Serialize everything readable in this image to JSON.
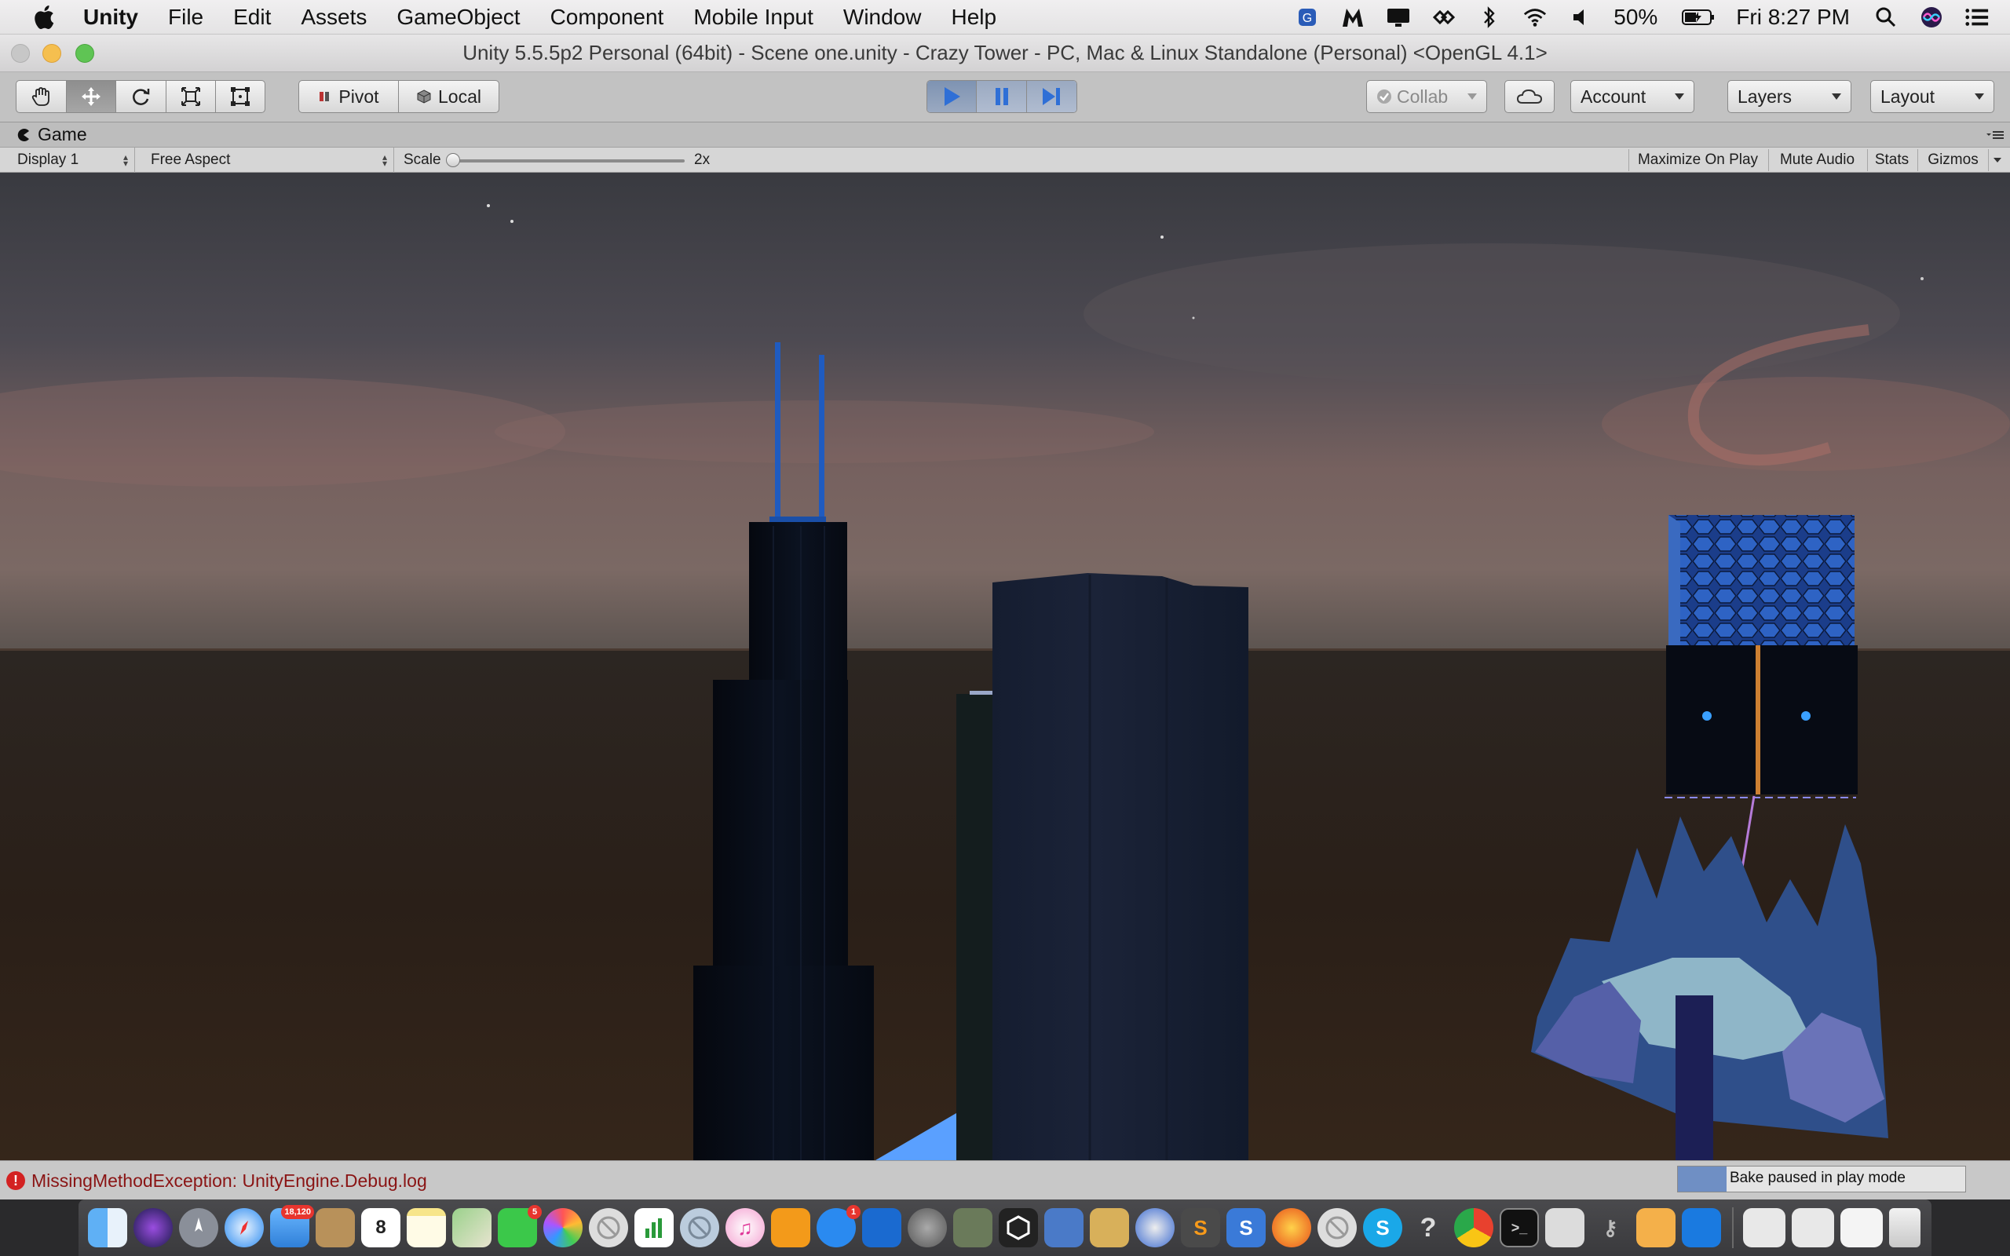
{
  "menubar": {
    "app_name": "Unity",
    "items": [
      "File",
      "Edit",
      "Assets",
      "GameObject",
      "Component",
      "Mobile Input",
      "Window",
      "Help"
    ],
    "battery": "50%",
    "clock": "Fri 8:27 PM"
  },
  "window": {
    "title": "Unity 5.5.5p2 Personal (64bit) - Scene one.unity - Crazy Tower - PC, Mac & Linux Standalone (Personal) <OpenGL 4.1>"
  },
  "toolbar": {
    "pivot_label": "Pivot",
    "local_label": "Local",
    "collab_label": "Collab",
    "account_label": "Account",
    "layers_label": "Layers",
    "layout_label": "Layout"
  },
  "game_view": {
    "tab_label": "Game",
    "display": "Display 1",
    "aspect": "Free Aspect",
    "scale_label": "Scale",
    "scale_value": "2x",
    "scale_fraction": 0.0,
    "toggles": [
      "Maximize On Play",
      "Mute Audio",
      "Stats",
      "Gizmos"
    ]
  },
  "statusbar": {
    "error_text": "MissingMethodException: UnityEngine.Debug.log",
    "bake_text": "Bake paused in play mode",
    "bake_progress": 0.17
  },
  "dock": {
    "badges": {
      "mail": "18,120",
      "calendar_day": "8",
      "facetime": "5",
      "appstore": "1"
    }
  },
  "colors": {
    "play_accent": "#2f6fd6",
    "error_red": "#d32222",
    "sky_top": "#3b3c43",
    "sky_horizon": "#8a6a62",
    "ground": "#241a14"
  }
}
